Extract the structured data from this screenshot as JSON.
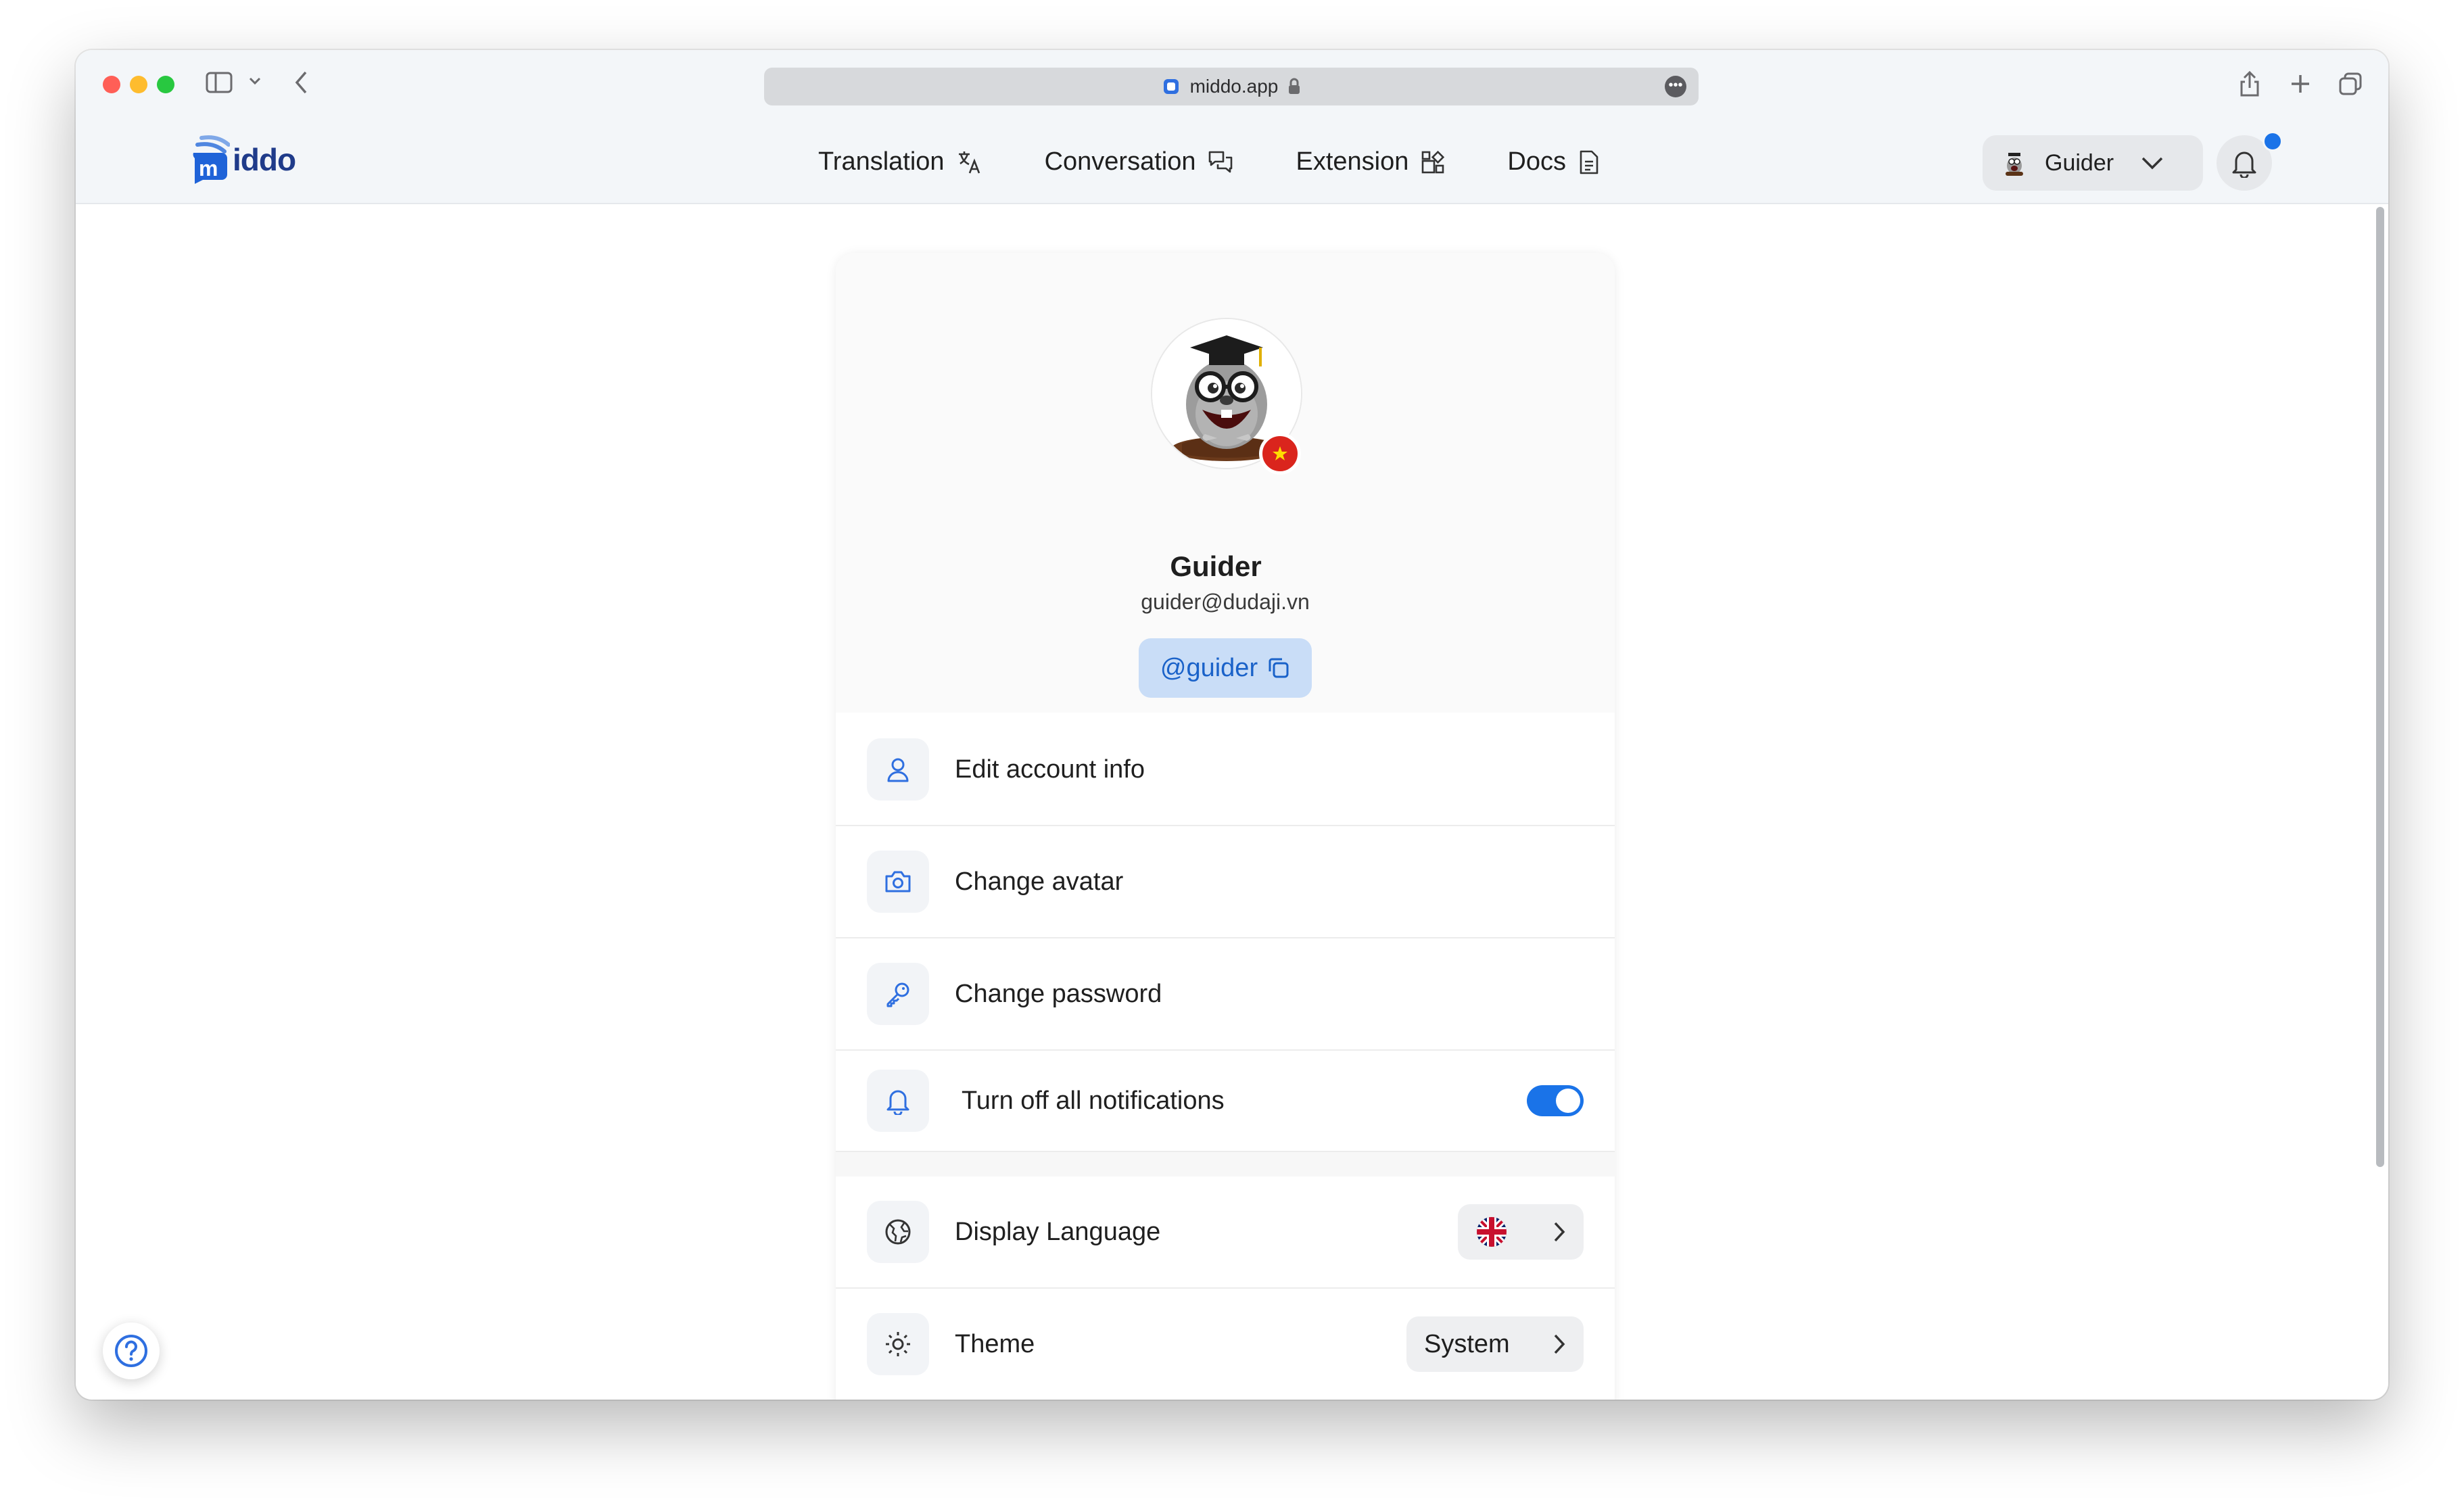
{
  "browser": {
    "url": "middo.app",
    "icons": [
      "sidebar-icon",
      "chevron-down-icon",
      "back-icon",
      "lock-icon",
      "more-icon",
      "share-icon",
      "new-tab-icon",
      "tabs-overview-icon"
    ]
  },
  "header": {
    "logo_text": "iddo",
    "nav": [
      {
        "label": "Translation",
        "icon": "translate-icon"
      },
      {
        "label": "Conversation",
        "icon": "chat-icon"
      },
      {
        "label": "Extension",
        "icon": "extension-icon"
      },
      {
        "label": "Docs",
        "icon": "document-icon"
      }
    ],
    "user_name": "Guider",
    "has_notification": true
  },
  "profile": {
    "name": "Guider",
    "email": "guider@dudaji.vn",
    "handle": "@guider",
    "country_flag": "vietnam"
  },
  "menu": [
    {
      "label": "Edit account info",
      "icon": "user-icon"
    },
    {
      "label": "Change avatar",
      "icon": "camera-icon"
    },
    {
      "label": "Change password",
      "icon": "key-icon"
    },
    {
      "label": "Turn off all notifications",
      "icon": "bell-icon",
      "toggle": true
    }
  ],
  "settings": [
    {
      "label": "Display Language",
      "icon": "globe-icon",
      "value_flag": "united-kingdom"
    },
    {
      "label": "Theme",
      "icon": "sun-icon",
      "value": "System"
    }
  ],
  "colors": {
    "accent": "#1a73e8",
    "handle_bg": "#c9ddf7",
    "handle_text": "#1a62c9",
    "brand": "#1f3b8a"
  }
}
